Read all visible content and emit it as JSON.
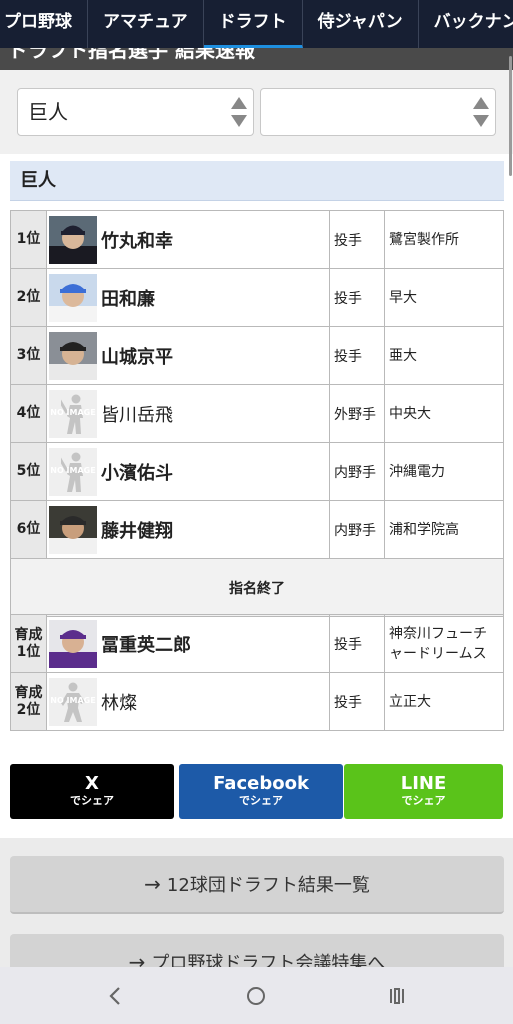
{
  "nav": {
    "tabs": [
      {
        "label": "プロ野球"
      },
      {
        "label": "アマチュア"
      },
      {
        "label": "ドラフト"
      },
      {
        "label": "侍ジャパン"
      },
      {
        "label": "バックナンバー"
      }
    ]
  },
  "headline": "ドラフト指名選手 結果速報",
  "filters": {
    "team_select": "巨人",
    "second_select": ""
  },
  "team_heading": "巨人",
  "picks": [
    {
      "rank": "1位",
      "name": "竹丸和幸",
      "position": "投手",
      "team": "鷺宮製作所",
      "photo": "player-photo"
    },
    {
      "rank": "2位",
      "name": "田和廉",
      "position": "投手",
      "team": "早大",
      "photo": "player-photo"
    },
    {
      "rank": "3位",
      "name": "山城京平",
      "position": "投手",
      "team": "亜大",
      "photo": "player-photo"
    },
    {
      "rank": "4位",
      "name": "皆川岳飛",
      "position": "外野手",
      "team": "中央大",
      "photo": "no-image"
    },
    {
      "rank": "5位",
      "name": "小濱佑斗",
      "position": "内野手",
      "team": "沖縄電力",
      "photo": "no-image"
    },
    {
      "rank": "6位",
      "name": "藤井健翔",
      "position": "内野手",
      "team": "浦和学院高",
      "photo": "player-photo"
    }
  ],
  "picks_end": "指名終了",
  "development_picks": [
    {
      "rank_line1": "育成",
      "rank_line2": "1位",
      "name": "冨重英二郎",
      "position": "投手",
      "team_line1": "神奈川フューチ",
      "team_line2": "ャードリームス",
      "photo": "player-photo"
    },
    {
      "rank_line1": "育成",
      "rank_line2": "2位",
      "name": "林燦",
      "position": "投手",
      "team_line1": "立正大",
      "team_line2": "",
      "photo": "no-image"
    }
  ],
  "no_image_text": "NO IMAGE",
  "share": {
    "x": {
      "label": "X",
      "sub": "でシェア",
      "color": "#000000"
    },
    "facebook": {
      "label": "Facebook",
      "sub": "でシェア",
      "color": "#1d5aa8"
    },
    "line": {
      "label": "LINE",
      "sub": "でシェア",
      "color": "#5ac31a"
    }
  },
  "links": [
    {
      "label": "12球団ドラフト結果一覧"
    },
    {
      "label": "プロ野球ドラフト会議特集へ"
    }
  ],
  "colors": {
    "nav_bg": "#171f33",
    "nav_active": "#1e8fe0",
    "team_head_bg": "#dfe8f5"
  },
  "system_nav": [
    "back-icon",
    "home-icon",
    "recents-icon"
  ]
}
